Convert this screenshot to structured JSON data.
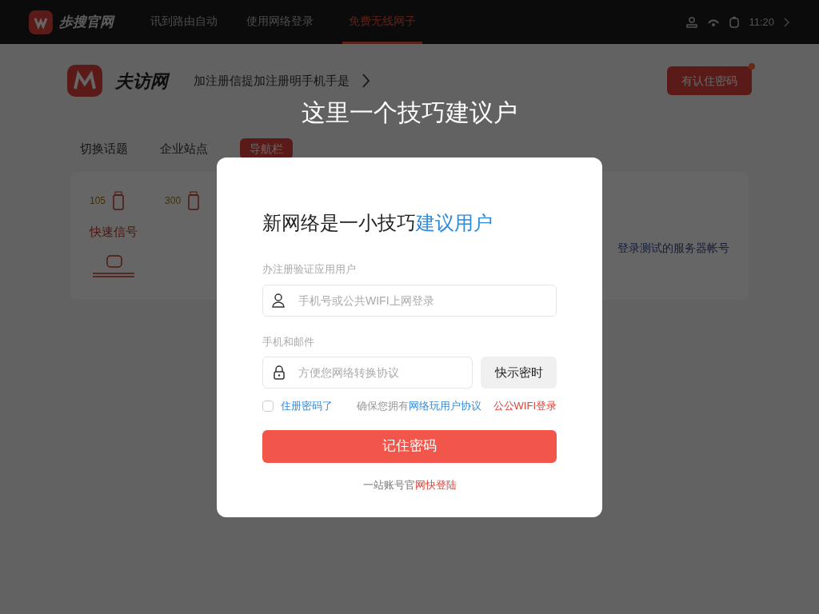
{
  "top_nav": {
    "logo_text": "歩搜官网",
    "items": [
      {
        "label": "讯到路由自动",
        "selected": false
      },
      {
        "label": "使用网络登录",
        "selected": false
      },
      {
        "label": "免费无线网子",
        "selected": true
      }
    ],
    "time": "11:20"
  },
  "header": {
    "logo_text": "夫访网",
    "breadcrumb": "加注册信提加注册明手机手是",
    "button": "有认住密码",
    "button_dot": true
  },
  "caption": "这里一个技巧建议户",
  "background": {
    "tabs": [
      {
        "label": "切换话题",
        "selected": false
      },
      {
        "label": "企业站点",
        "selected": false
      },
      {
        "label": "导航栏",
        "selected": true
      }
    ],
    "items": [
      {
        "label": "105",
        "kind": "stat"
      },
      {
        "label": "300",
        "kind": "stat"
      }
    ],
    "link": "快速信号",
    "side_text": "登录测试的服务器帐号"
  },
  "modal": {
    "title": "新网络是一小技巧",
    "title_highlight": "建议用户",
    "username": {
      "label": "办注册验证应用用户",
      "placeholder": "手机号或公共WIFI上网登录"
    },
    "password": {
      "label": "手机和邮件",
      "placeholder": "方便您网络转换协议"
    },
    "code_button": "快示密时",
    "remember": {
      "label": "住册密码了",
      "checked": false
    },
    "agreement": "确保您拥有",
    "agreement_link": "网络玩用户协议",
    "wifi_link": "公公WIFI登录",
    "submit": "记住密码",
    "footer": "一站账号官",
    "footer_link": "网快登陆"
  }
}
